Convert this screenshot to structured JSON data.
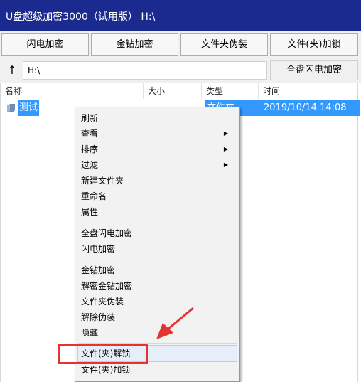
{
  "window": {
    "title": "U盘超级加密3000（试用版） H:\\"
  },
  "toolbar": {
    "flash_encrypt": "闪电加密",
    "diamond_encrypt": "金钻加密",
    "folder_disguise": "文件夹伪装",
    "folder_lock": "文件(夹)加锁"
  },
  "pathbar": {
    "up_arrow": "↑",
    "path": "H:\\",
    "full_disk_flash": "全盘闪电加密"
  },
  "list": {
    "headers": {
      "name": "名称",
      "size": "大小",
      "type": "类型",
      "time": "时间"
    },
    "row": {
      "name": "测试",
      "type": "文件夹",
      "time": "2019/10/14 14:08"
    }
  },
  "menu": {
    "refresh": "刷新",
    "view": "查看",
    "sort": "排序",
    "filter": "过滤",
    "new_folder": "新建文件夹",
    "rename": "重命名",
    "properties": "属性",
    "full_disk_flash": "全盘闪电加密",
    "flash_encrypt": "闪电加密",
    "diamond_encrypt": "金钻加密",
    "diamond_decrypt": "解密金钻加密",
    "folder_disguise": "文件夹伪装",
    "remove_disguise": "解除伪装",
    "hide": "隐藏",
    "folder_unlock": "文件(夹)解锁",
    "folder_lock": "文件(夹)加锁",
    "submenu_arrow": "▶"
  },
  "colors": {
    "title_bg": "#1b2a8f",
    "selection": "#3399ff",
    "annotation_red": "#e53333"
  },
  "icons": {
    "folder": "folder-icon",
    "annotation": "arrow-annotation-icon"
  }
}
